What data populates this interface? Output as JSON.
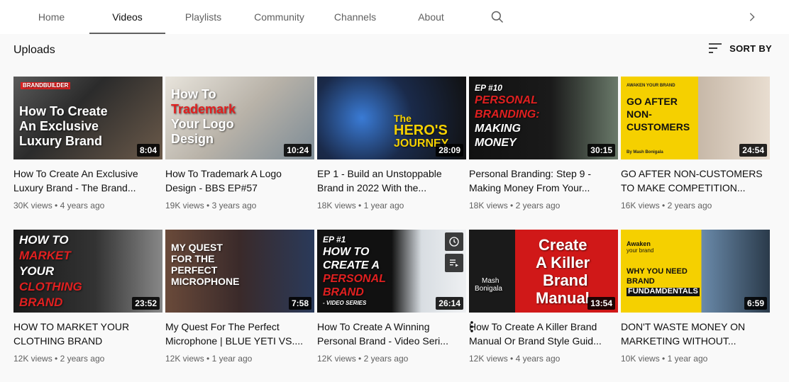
{
  "tabs": [
    {
      "label": "Home",
      "active": false
    },
    {
      "label": "Videos",
      "active": true
    },
    {
      "label": "Playlists",
      "active": false
    },
    {
      "label": "Community",
      "active": false
    },
    {
      "label": "Channels",
      "active": false
    },
    {
      "label": "About",
      "active": false
    }
  ],
  "icons": {
    "search": "search-icon",
    "next": "chevron-right-icon",
    "sort": "sort-icon",
    "more": "more-vert-icon",
    "watch_later": "clock-icon",
    "add_queue": "queue-icon"
  },
  "section": {
    "title": "Uploads",
    "sort_label": "SORT BY"
  },
  "colors": {
    "accent_red": "#e02020",
    "yellow": "#f5d000",
    "text": "#0f0f0f",
    "secondary": "#606060"
  },
  "videos": [
    {
      "title": "How To Create An Exclusive Luxury Brand - The Brand...",
      "views": "30K views",
      "age": "4 years ago",
      "duration": "8:04",
      "thumb_lines": [
        "How To Create",
        "An Exclusive",
        "Luxury Brand"
      ],
      "thumb_brand": "BRANDBUILDER"
    },
    {
      "title": "How To Trademark A Logo Design - BBS EP#57",
      "views": "19K views",
      "age": "3 years ago",
      "duration": "10:24",
      "thumb_lines": [
        "How To",
        "Trademark",
        "Your Logo",
        "Design"
      ]
    },
    {
      "title": "EP 1 - Build an Unstoppable Brand in 2022 With the...",
      "views": "18K views",
      "age": "1 year ago",
      "duration": "28:09",
      "thumb_lines": [
        "The",
        "HERO'S",
        "JOURNEY"
      ]
    },
    {
      "title": "Personal Branding: Step 9 - Making Money From Your...",
      "views": "18K views",
      "age": "2 years ago",
      "duration": "30:15",
      "thumb_lines": [
        "EP #10",
        "PERSONAL",
        "BRANDING:",
        "MAKING",
        "MONEY"
      ]
    },
    {
      "title": "GO AFTER NON-CUSTOMERS TO MAKE COMPETITION...",
      "views": "16K views",
      "age": "2 years ago",
      "duration": "24:54",
      "thumb_lines": [
        "AWAKEN YOUR BRAND",
        "GO AFTER",
        "NON-",
        "CUSTOMERS",
        "By Mash Bonigala"
      ]
    },
    {
      "title": "HOW TO MARKET YOUR CLOTHING BRAND",
      "views": "12K views",
      "age": "2 years ago",
      "duration": "23:52",
      "thumb_lines": [
        "HOW TO",
        "MARKET",
        "YOUR",
        "CLOTHING",
        "BRAND"
      ]
    },
    {
      "title": "My Quest For The Perfect Microphone | BLUE YETI VS....",
      "views": "12K views",
      "age": "1 year ago",
      "duration": "7:58",
      "thumb_lines": [
        "MY QUEST",
        "FOR THE",
        "PERFECT",
        "MICROPHONE"
      ]
    },
    {
      "title": "How To Create A Winning Personal Brand - Video Seri...",
      "views": "12K views",
      "age": "2 years ago",
      "duration": "26:14",
      "thumb_lines": [
        "EP #1",
        "HOW TO",
        "CREATE A",
        "PERSONAL",
        "BRAND",
        "- VIDEO SERIES"
      ]
    },
    {
      "title": "How To Create A Killer Brand Manual Or Brand Style Guid...",
      "views": "12K views",
      "age": "4 years ago",
      "duration": "13:54",
      "thumb_lines": [
        "Create",
        "A Killer",
        "Brand",
        "Manual",
        "Mash",
        "Bonigala"
      ]
    },
    {
      "title": "DON'T WASTE MONEY ON MARKETING WITHOUT...",
      "views": "10K views",
      "age": "1 year ago",
      "duration": "6:59",
      "thumb_lines": [
        "Awaken",
        "your brand",
        "WHY YOU NEED",
        "BRAND",
        "FUNDAMDENTALS"
      ]
    }
  ]
}
